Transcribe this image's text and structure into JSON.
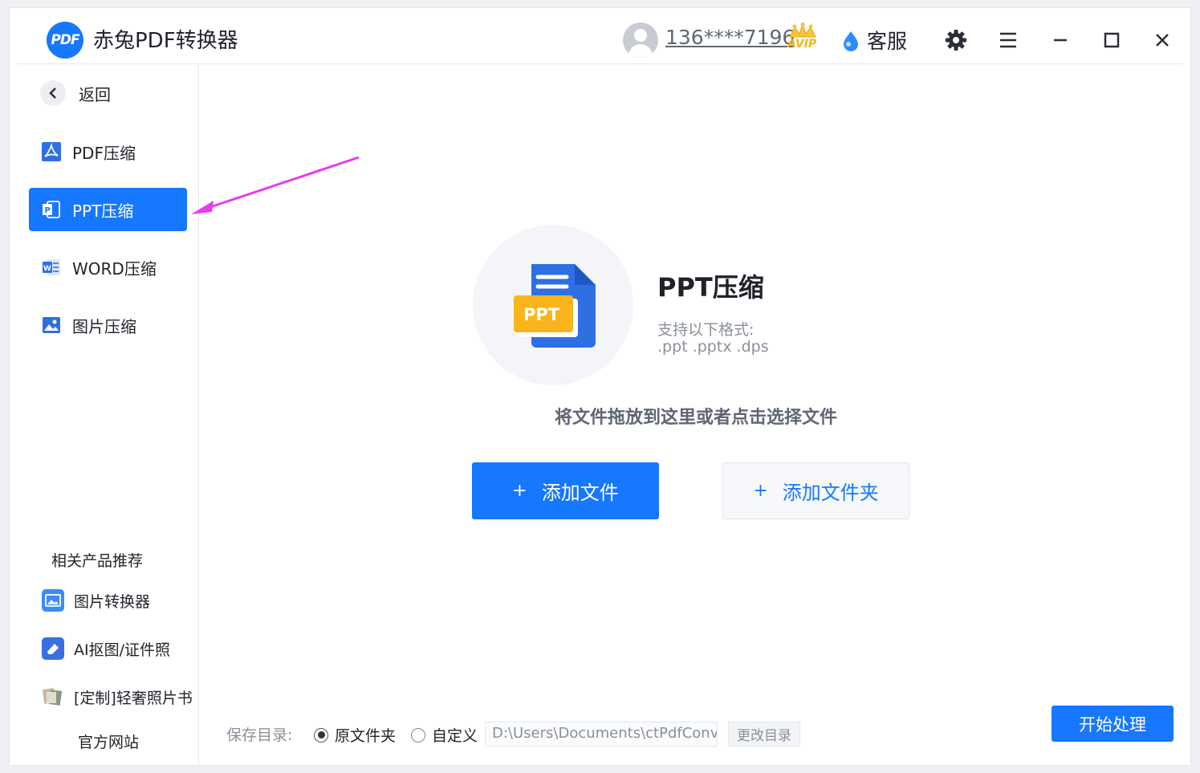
{
  "app": {
    "logo_text": "PDF",
    "title": "赤兔PDF转换器"
  },
  "header": {
    "phone": "136****7196",
    "vip_badge": "AVIP",
    "service_label": "客服",
    "icons": [
      "user-avatar-icon",
      "crown-icon",
      "service-icon",
      "gear-icon",
      "menu-icon",
      "minimize-icon",
      "maximize-icon",
      "close-icon"
    ]
  },
  "sidebar": {
    "back_label": "返回",
    "items": [
      {
        "label": "PDF压缩",
        "icon": "pdf-icon",
        "active": false
      },
      {
        "label": "PPT压缩",
        "icon": "ppt-icon",
        "active": true
      },
      {
        "label": "WORD压缩",
        "icon": "word-icon",
        "active": false
      },
      {
        "label": "图片压缩",
        "icon": "image-icon",
        "active": false
      }
    ],
    "related_title": "相关产品推荐",
    "related": [
      {
        "label": "图片转换器",
        "icon": "image-converter-icon"
      },
      {
        "label": "AI抠图/证件照",
        "icon": "eraser-icon"
      },
      {
        "label": "[定制]轻奢照片书",
        "icon": "photo-book-icon"
      }
    ],
    "official_site": "官方网站"
  },
  "main": {
    "doc_badge": "PPT",
    "title": "PPT压缩",
    "formats_label": "支持以下格式:",
    "formats": ".ppt .pptx .dps",
    "drop_hint": "将文件拖放到这里或者点击选择文件",
    "add_file": "添加文件",
    "add_folder": "添加文件夹",
    "plus": "+"
  },
  "footer": {
    "save_label": "保存目录:",
    "option_original": "原文件夹",
    "option_custom": "自定义",
    "selected_option": "原文件夹",
    "path": "D:\\Users\\Documents\\ctPdfConv",
    "change_dir": "更改目录",
    "start": "开始处理"
  },
  "colors": {
    "accent": "#1677ff",
    "ppt_badge": "#f9b51b",
    "arrow": "#e83bf0"
  }
}
